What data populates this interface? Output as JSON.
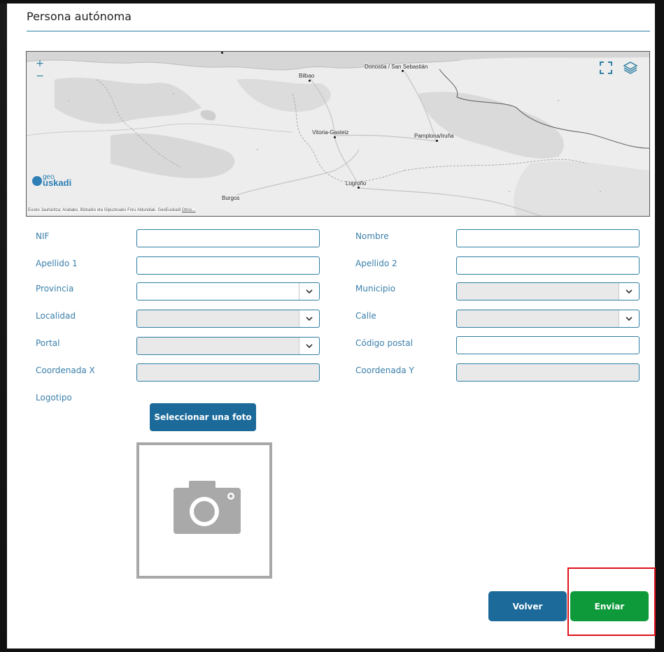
{
  "page": {
    "title": "Persona autónoma"
  },
  "map": {
    "zoom_in": "+",
    "zoom_out": "−",
    "cities": {
      "bilbao": "Bilbao",
      "donostia": "Donostia / San Sebastián",
      "vitoria": "Vitoria-Gasteiz",
      "pamplona": "Pamplona/Iruña",
      "logrono": "Logroño",
      "burgos": "Burgos"
    },
    "logo_geo": "geo",
    "logo_uskadi": "uskadi",
    "attribution": "Eusko Jaurlaritza; Arabako, Bizkaiko eta Gipuzkoako Foru Aldundiak. GeoEuskadi",
    "attribution_link": "Otros...",
    "icons": {
      "fullscreen": "fullscreen-icon",
      "layers": "layers-icon"
    }
  },
  "form": {
    "nif": {
      "label": "NIF",
      "value": ""
    },
    "nombre": {
      "label": "Nombre",
      "value": ""
    },
    "apellido1": {
      "label": "Apellido 1",
      "value": ""
    },
    "apellido2": {
      "label": "Apellido 2",
      "value": ""
    },
    "provincia": {
      "label": "Provincia",
      "value": ""
    },
    "municipio": {
      "label": "Municipio",
      "value": ""
    },
    "localidad": {
      "label": "Localidad",
      "value": ""
    },
    "calle": {
      "label": "Calle",
      "value": ""
    },
    "portal": {
      "label": "Portal",
      "value": ""
    },
    "codigo_postal": {
      "label": "Código postal",
      "value": ""
    },
    "coordenada_x": {
      "label": "Coordenada X",
      "value": ""
    },
    "coordenada_y": {
      "label": "Coordenada Y",
      "value": ""
    },
    "logotipo": {
      "label": "Logotipo"
    }
  },
  "buttons": {
    "select_photo": "Seleccionar una foto",
    "volver": "Volver",
    "enviar": "Enviar"
  },
  "colors": {
    "accent": "#2e7fa3",
    "primary_button": "#1b6a9a",
    "submit_button": "#0e9a3a",
    "highlight": "#e0101a"
  }
}
